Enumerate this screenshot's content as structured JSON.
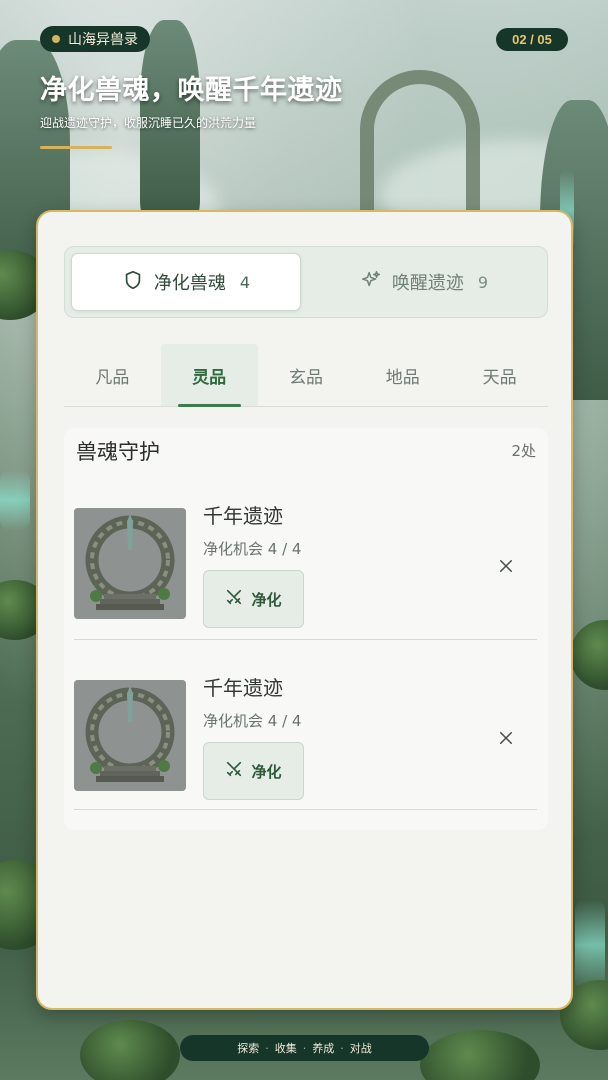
{
  "header": {
    "badge_label": "山海异兽录",
    "pager": "02 / 05",
    "title": "净化兽魂，唤醒千年遗迹",
    "subtitle": "迎战遗迹守护，收服沉睡已久的洪荒力量"
  },
  "segment": {
    "tabs": [
      {
        "label": "净化兽魂",
        "count": "4",
        "icon": "shield-icon",
        "active": true
      },
      {
        "label": "唤醒遗迹",
        "count": "9",
        "icon": "sparkle-icon",
        "active": false
      }
    ]
  },
  "tiers": {
    "items": [
      "凡品",
      "灵品",
      "玄品",
      "地品",
      "天品"
    ],
    "active": "灵品"
  },
  "section": {
    "title": "兽魂守护",
    "count": "2处",
    "items": [
      {
        "name": "千年遗迹",
        "chance": "净化机会 4 / 4",
        "action": "净化"
      },
      {
        "name": "千年遗迹",
        "chance": "净化机会 4 / 4",
        "action": "净化"
      }
    ]
  },
  "bottom_nav": {
    "items": [
      "探索",
      "收集",
      "养成",
      "对战"
    ],
    "separator": "·"
  },
  "colors": {
    "accent_gold": "#d6b25e",
    "dark_green": "#17362a",
    "active_green": "#2d6a3e"
  }
}
